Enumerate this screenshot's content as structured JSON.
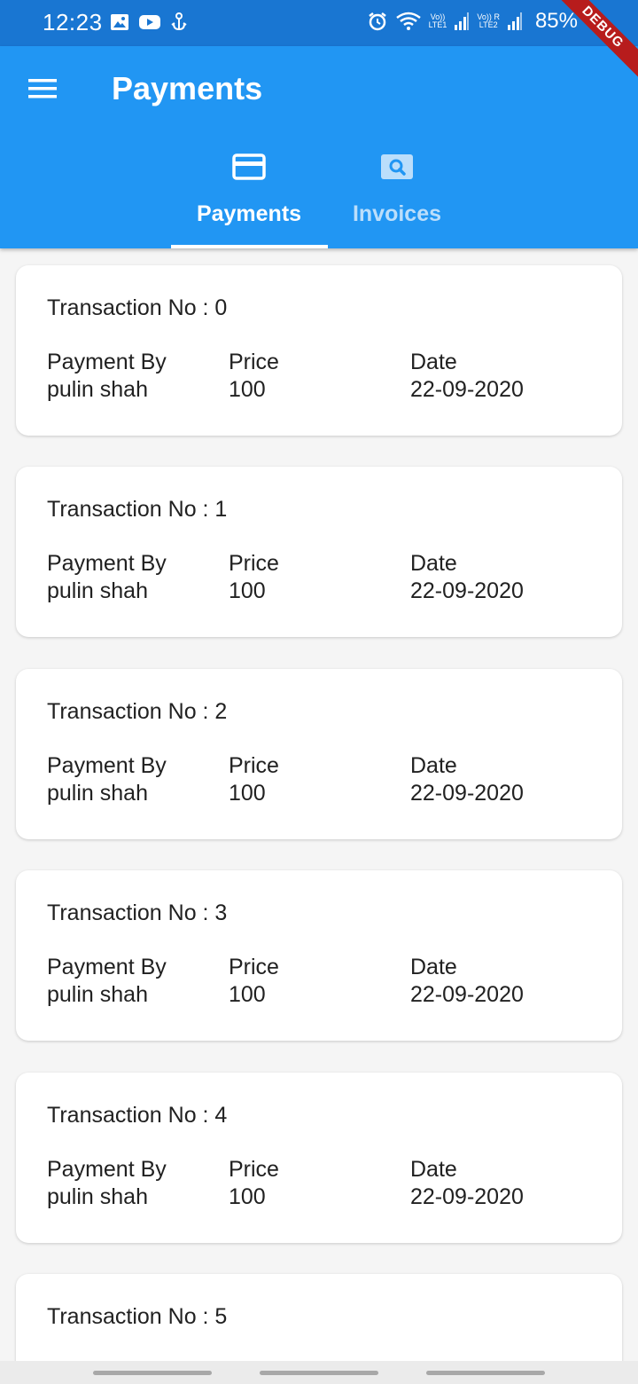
{
  "status_bar": {
    "time": "12:23",
    "battery": "85%",
    "sim1_top": "Vo))",
    "sim1_bottom": "LTE1",
    "sim2_top": "Vo))",
    "sim2_bottom": "LTE2",
    "sim2_roaming": "R",
    "icons_left": [
      "image-icon",
      "youtube-icon",
      "notification-icon"
    ],
    "icons_right": [
      "alarm-icon",
      "wifi-icon",
      "signal-icon"
    ]
  },
  "debug_banner": "DEBUG",
  "app_bar": {
    "title": "Payments",
    "background": "#2196f3",
    "status_background": "#1976d2"
  },
  "tabs": [
    {
      "label": "Payments",
      "icon": "credit-card-icon",
      "selected": true
    },
    {
      "label": "Invoices",
      "icon": "search-icon",
      "selected": false
    }
  ],
  "labels": {
    "payment_by": "Payment By",
    "price": "Price",
    "date": "Date"
  },
  "transactions": [
    {
      "title": "Transaction No : 0",
      "payment_by": "pulin shah",
      "price": "100",
      "date": "22-09-2020"
    },
    {
      "title": "Transaction No : 1",
      "payment_by": "pulin shah",
      "price": "100",
      "date": "22-09-2020"
    },
    {
      "title": "Transaction No : 2",
      "payment_by": "pulin shah",
      "price": "100",
      "date": "22-09-2020"
    },
    {
      "title": "Transaction No : 3",
      "payment_by": "pulin shah",
      "price": "100",
      "date": "22-09-2020"
    },
    {
      "title": "Transaction No : 4",
      "payment_by": "pulin shah",
      "price": "100",
      "date": "22-09-2020"
    },
    {
      "title": "Transaction No : 5"
    }
  ]
}
